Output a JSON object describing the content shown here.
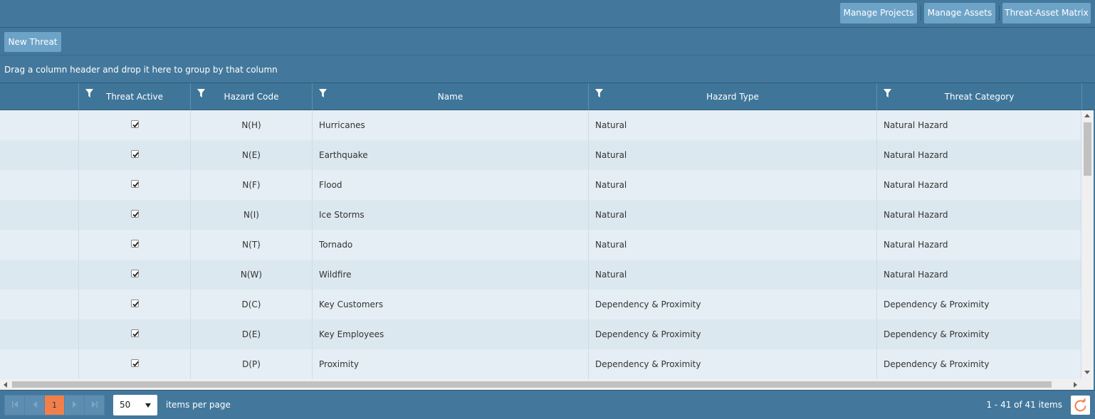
{
  "nav": {
    "manage_projects": "Manage Projects",
    "manage_assets": "Manage Assets",
    "threat_asset_matrix": "Threat-Asset Matrix"
  },
  "toolbar": {
    "new_threat": "New Threat"
  },
  "group_panel": {
    "hint": "Drag a column header and drop it here to group by that column"
  },
  "columns": {
    "threat_active": "Threat Active",
    "hazard_code": "Hazard Code",
    "name": "Name",
    "hazard_type": "Hazard Type",
    "threat_category": "Threat Category"
  },
  "rows": [
    {
      "active": true,
      "code": "N(H)",
      "name": "Hurricanes",
      "type": "Natural",
      "category": "Natural Hazard"
    },
    {
      "active": true,
      "code": "N(E)",
      "name": "Earthquake",
      "type": "Natural",
      "category": "Natural Hazard"
    },
    {
      "active": true,
      "code": "N(F)",
      "name": "Flood",
      "type": "Natural",
      "category": "Natural Hazard"
    },
    {
      "active": true,
      "code": "N(I)",
      "name": "Ice Storms",
      "type": "Natural",
      "category": "Natural Hazard"
    },
    {
      "active": true,
      "code": "N(T)",
      "name": "Tornado",
      "type": "Natural",
      "category": "Natural Hazard"
    },
    {
      "active": true,
      "code": "N(W)",
      "name": "Wildfire",
      "type": "Natural",
      "category": "Natural Hazard"
    },
    {
      "active": true,
      "code": "D(C)",
      "name": "Key Customers",
      "type": "Dependency & Proximity",
      "category": "Dependency & Proximity"
    },
    {
      "active": true,
      "code": "D(E)",
      "name": "Key Employees",
      "type": "Dependency & Proximity",
      "category": "Dependency & Proximity"
    },
    {
      "active": true,
      "code": "D(P)",
      "name": "Proximity",
      "type": "Dependency & Proximity",
      "category": "Dependency & Proximity"
    }
  ],
  "pager": {
    "current_page": "1",
    "page_size": "50",
    "items_per_page_label": "items per page",
    "info": "1 - 41 of 41 items"
  },
  "colors": {
    "accent": "#f27f4a",
    "header_bg": "#43789c",
    "button_bg": "#6ea3c8"
  }
}
